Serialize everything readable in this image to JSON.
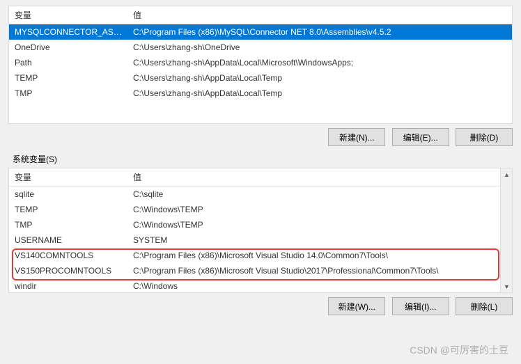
{
  "top": {
    "headers": {
      "var": "变量",
      "val": "值"
    },
    "rows": [
      {
        "var": "MYSQLCONNECTOR_ASS...",
        "val": "C:\\Program Files (x86)\\MySQL\\Connector NET 8.0\\Assemblies\\v4.5.2",
        "selected": true
      },
      {
        "var": "OneDrive",
        "val": "C:\\Users\\zhang-sh\\OneDrive"
      },
      {
        "var": "Path",
        "val": "C:\\Users\\zhang-sh\\AppData\\Local\\Microsoft\\WindowsApps;"
      },
      {
        "var": "TEMP",
        "val": "C:\\Users\\zhang-sh\\AppData\\Local\\Temp"
      },
      {
        "var": "TMP",
        "val": "C:\\Users\\zhang-sh\\AppData\\Local\\Temp"
      }
    ],
    "buttons": {
      "new": "新建(N)...",
      "edit": "编辑(E)...",
      "delete": "删除(D)"
    }
  },
  "group_label": "系统变量(S)",
  "bottom": {
    "headers": {
      "var": "变量",
      "val": "值"
    },
    "rows": [
      {
        "var": "sqlite",
        "val": "C:\\sqlite"
      },
      {
        "var": "TEMP",
        "val": "C:\\Windows\\TEMP"
      },
      {
        "var": "TMP",
        "val": "C:\\Windows\\TEMP"
      },
      {
        "var": "USERNAME",
        "val": "SYSTEM"
      },
      {
        "var": "VS140COMNTOOLS",
        "val": "C:\\Program Files (x86)\\Microsoft Visual Studio 14.0\\Common7\\Tools\\"
      },
      {
        "var": "VS150PROCOMNTOOLS",
        "val": "C:\\Program Files (x86)\\Microsoft Visual Studio\\2017\\Professional\\Common7\\Tools\\"
      },
      {
        "var": "windir",
        "val": "C:\\Windows"
      }
    ],
    "buttons": {
      "new": "新建(W)...",
      "edit": "编辑(I)...",
      "delete": "删除(L)"
    }
  },
  "watermark": "CSDN @可厉害的土豆"
}
